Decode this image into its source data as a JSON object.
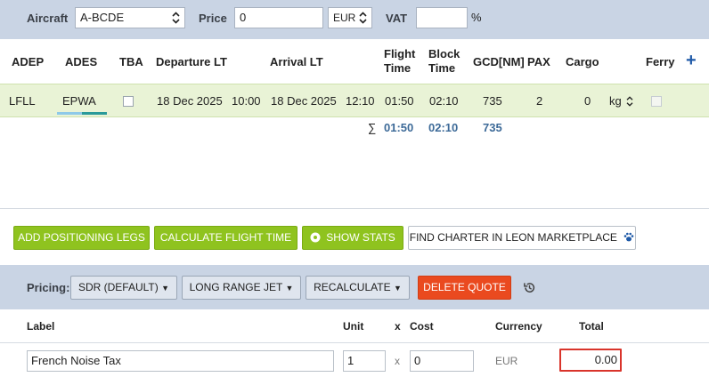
{
  "topbar": {
    "aircraft_label": "Aircraft",
    "aircraft_value": "A-BCDE",
    "price_label": "Price",
    "price_value": "0",
    "currency_value": "EUR",
    "vat_label": "VAT",
    "vat_value": "",
    "percent": "%"
  },
  "grid": {
    "headers": {
      "adep": "ADEP",
      "ades": "ADES",
      "tba": "TBA",
      "departure": "Departure LT",
      "arrival": "Arrival LT",
      "flight_time_1": "Flight",
      "flight_time_2": "Time",
      "block_time_1": "Block",
      "block_time_2": "Time",
      "gcd": "GCD[NM]",
      "pax": "PAX",
      "cargo": "Cargo",
      "ferry": "Ferry"
    },
    "row": {
      "adep": "LFLL",
      "ades": "EPWA",
      "dep_date": "18 Dec 2025",
      "dep_time": "10:00",
      "arr_date": "18 Dec 2025",
      "arr_time": "12:10",
      "flight_time": "01:50",
      "block_time": "02:10",
      "gcd": "735",
      "pax": "2",
      "cargo": "0",
      "cargo_unit": "kg"
    },
    "totals": {
      "sigma": "∑",
      "flight_time": "01:50",
      "block_time": "02:10",
      "gcd": "735"
    }
  },
  "actions": {
    "add_positioning": "ADD POSITIONING LEGS",
    "calc_flight_time": "CALCULATE FLIGHT TIME",
    "show_stats": "SHOW STATS",
    "find_charter": "FIND CHARTER IN LEON MARKETPLACE"
  },
  "pricing": {
    "label": "Pricing:",
    "scheme": "SDR (DEFAULT)",
    "category": "LONG RANGE JET",
    "recalculate": "RECALCULATE",
    "delete_quote": "DELETE QUOTE"
  },
  "price_table": {
    "headers": {
      "label": "Label",
      "unit": "Unit",
      "x": "x",
      "cost": "Cost",
      "currency": "Currency",
      "total": "Total"
    },
    "row": {
      "label": "French Noise Tax",
      "unit": "1",
      "x": "x",
      "cost": "0",
      "currency": "EUR",
      "total": "0.00"
    }
  },
  "colors": {
    "accent_green": "#8fc31f",
    "accent_red": "#ea4a1f",
    "header_bg": "#c9d4e4",
    "row_bg": "#e9f3d6",
    "total_highlight": "#d9342b"
  }
}
